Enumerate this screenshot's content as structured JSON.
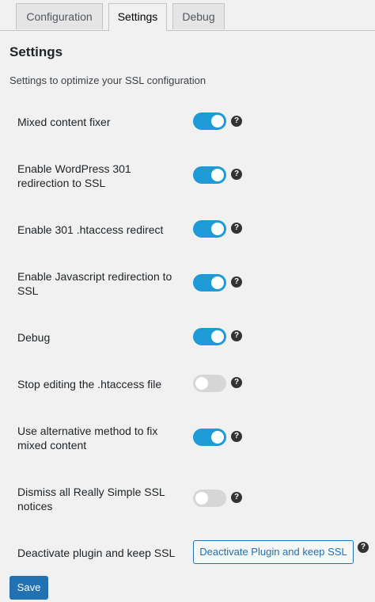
{
  "tabs": [
    "Configuration",
    "Settings",
    "Debug"
  ],
  "active_tab": "Settings",
  "section": {
    "title": "Settings",
    "description": "Settings to optimize your SSL configuration"
  },
  "settings": [
    {
      "label": "Mixed content fixer",
      "enabled": true
    },
    {
      "label": "Enable WordPress 301 redirection to SSL",
      "enabled": true
    },
    {
      "label": "Enable 301 .htaccess redirect",
      "enabled": true
    },
    {
      "label": "Enable Javascript redirection to SSL",
      "enabled": true
    },
    {
      "label": "Debug",
      "enabled": true
    },
    {
      "label": "Stop editing the .htaccess file",
      "enabled": false
    },
    {
      "label": "Use alternative method to fix mixed content",
      "enabled": true
    },
    {
      "label": "Dismiss all Really Simple SSL notices",
      "enabled": false
    }
  ],
  "deactivate": {
    "label": "Deactivate plugin and keep SSL",
    "button_label": "Deactivate Plugin and keep SSL"
  },
  "help_glyph": "?",
  "save_label": "Save",
  "colors": {
    "toggle_on": "#1e9ad6",
    "toggle_off": "#d6d6d6",
    "primary": "#2271b1"
  }
}
